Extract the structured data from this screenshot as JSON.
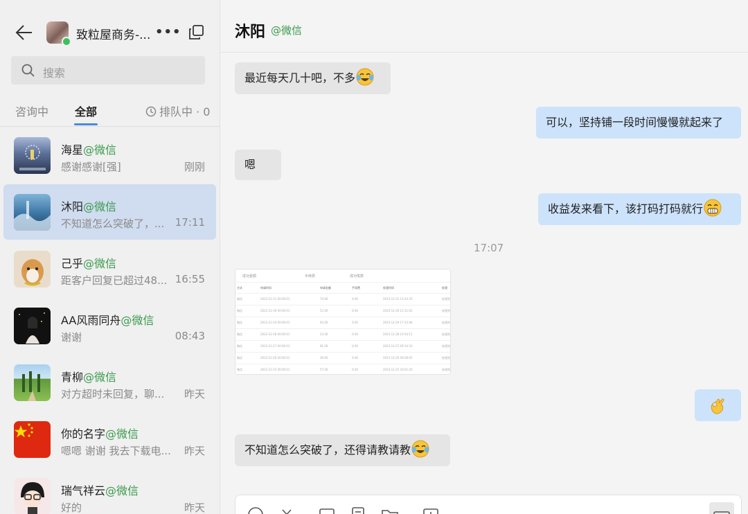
{
  "sidebar": {
    "shop_name": "致粒屋商务-...",
    "more_label": "•••",
    "search_placeholder": "搜索",
    "tabs": [
      {
        "label": "咨询中"
      },
      {
        "label": "全部"
      }
    ],
    "queue_label": "排队中 · 0",
    "conversations": [
      {
        "name": "海星",
        "source": "@微信",
        "preview": "感谢感谢[强]",
        "time": "刚刚"
      },
      {
        "name": "沐阳",
        "source": "@微信",
        "preview": "不知道怎么突破了，...",
        "time": "17:11"
      },
      {
        "name": "己乎",
        "source": "@微信",
        "preview": "距客户回复已超过48...",
        "time": "16:55"
      },
      {
        "name": "AA风雨同舟",
        "source": "@微信",
        "preview": "谢谢",
        "time": "08:43"
      },
      {
        "name": "青柳",
        "source": "@微信",
        "preview": "对方超时未回复，聊...",
        "time": "昨天"
      },
      {
        "name": "你的名字",
        "source": "@微信",
        "preview": "嗯嗯 谢谢 我去下载电...",
        "time": "昨天"
      },
      {
        "name": "瑞气祥云",
        "source": "@微信",
        "preview": "好的",
        "time": "昨天"
      }
    ]
  },
  "chat": {
    "title": "沐阳",
    "source": "@微信",
    "time_divider": "17:07",
    "messages": [
      {
        "text": "最近每天几十吧，不多",
        "emoji": "face-with-tears-of-joy"
      },
      {
        "text": "可以，坚持铺一段时间慢慢就起来了"
      },
      {
        "text": "嗯"
      },
      {
        "text": "收益发来看下，该打码打码就行",
        "emoji": "grinning-face"
      },
      {
        "emoji": "ok-hand"
      },
      {
        "text": "不知道怎么突破了，还得请教请教",
        "emoji": "face-with-tears-of-joy"
      }
    ],
    "image_table": {
      "tabs": [
        "成功金额",
        "手续费",
        "成功笔数"
      ],
      "headers": [
        "方式",
        "申请时间",
        "申请金额",
        "手续费",
        "处理时间",
        "处理"
      ],
      "rows": [
        [
          "微信",
          "2023-12-31 00:00:01",
          "74.00",
          "0.00",
          "2023-12-31 15:43:35",
          "处理完"
        ],
        [
          "微信",
          "2023-12-30 00:00:01",
          "52.00",
          "0.00",
          "2023-12-30 11:11:02",
          "处理完"
        ],
        [
          "微信",
          "2023-12-29 00:00:01",
          "63.00",
          "0.00",
          "2023-12-29 17:15:46",
          "处理完"
        ],
        [
          "微信",
          "2023-12-28 00:00:01",
          "23.00",
          "0.00",
          "2023-12-28 10:54:11",
          "处理完"
        ],
        [
          "微信",
          "2023-12-27 00:00:01",
          "81.00",
          "0.00",
          "2023-12-27 09:14:33",
          "处理完"
        ],
        [
          "微信",
          "2023-12-26 00:00:01",
          "39.00",
          "0.00",
          "2023-12-26 09:28:05",
          "处理完"
        ],
        [
          "微信",
          "2023-12-25 00:00:01",
          "57.00",
          "0.00",
          "2023-12-25 18:01:20",
          "处理完"
        ]
      ]
    }
  },
  "colors": {
    "accent": "#4a8ad8",
    "source_green": "#3a9a4c",
    "online": "#3cc15a",
    "incoming_bubble": "#e5e5e5",
    "outgoing_bubble": "#cde3fb",
    "active_conversation": "#d0dcef"
  }
}
